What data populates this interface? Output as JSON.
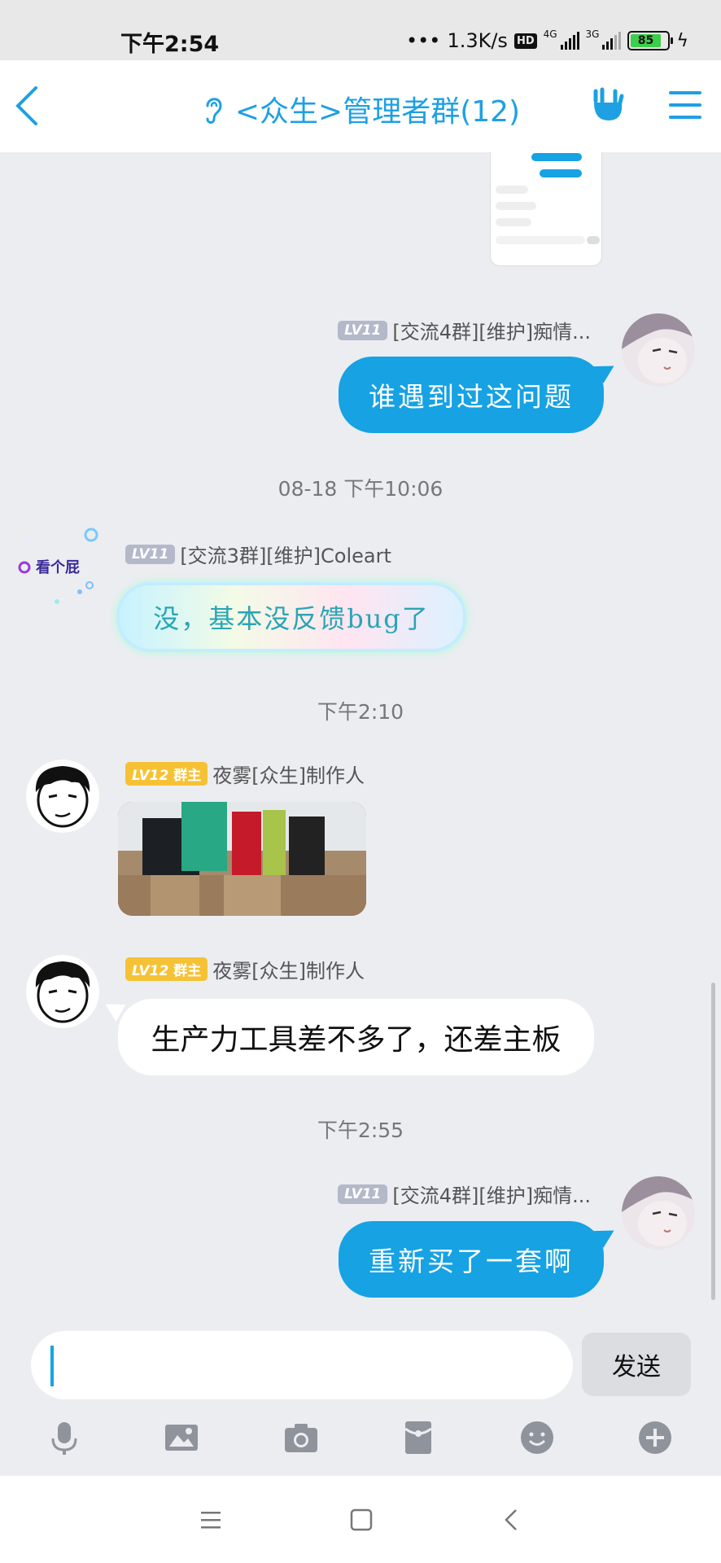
{
  "status_bar": {
    "time": "下午2:54",
    "net_speed": "1.3K/s",
    "hd": "HD",
    "sim1": "4G",
    "sim2": "3G",
    "battery": "85"
  },
  "header": {
    "title": "<众生>管理者群(12)",
    "icons": [
      "back-icon",
      "ear-icon",
      "hand-gesture-icon",
      "menu-icon"
    ]
  },
  "messages": [
    {
      "level": "LV11",
      "sender": "[交流4群][维护]痴情...",
      "text": "谁遇到过这问题"
    },
    {
      "timestamp": "08-18 下午10:06"
    },
    {
      "level": "LV11",
      "sender": "[交流3群][维护]Coleart",
      "badge_text": "看个屁",
      "text": "没，基本没反馈bug了"
    },
    {
      "timestamp": "下午2:10"
    },
    {
      "level": "LV12",
      "role": "群主",
      "sender": "夜雾[众生]制作人",
      "image": "photo-of-hardware-boxes"
    },
    {
      "level": "LV12",
      "role": "群主",
      "sender": "夜雾[众生]制作人",
      "text": "生产力工具差不多了，还差主板"
    },
    {
      "timestamp": "下午2:55"
    },
    {
      "level": "LV11",
      "sender": "[交流4群][维护]痴情...",
      "text": "重新买了一套啊"
    }
  ],
  "input": {
    "placeholder": "",
    "send_label": "发送",
    "tools": [
      "microphone-icon",
      "image-icon",
      "camera-icon",
      "red-packet-icon",
      "emoji-icon",
      "plus-icon"
    ]
  },
  "colors": {
    "accent": "#16a2e3",
    "gold_badge": "#f6c235",
    "grey_badge": "#b3b9c9",
    "chat_bg": "#ecedf1"
  }
}
